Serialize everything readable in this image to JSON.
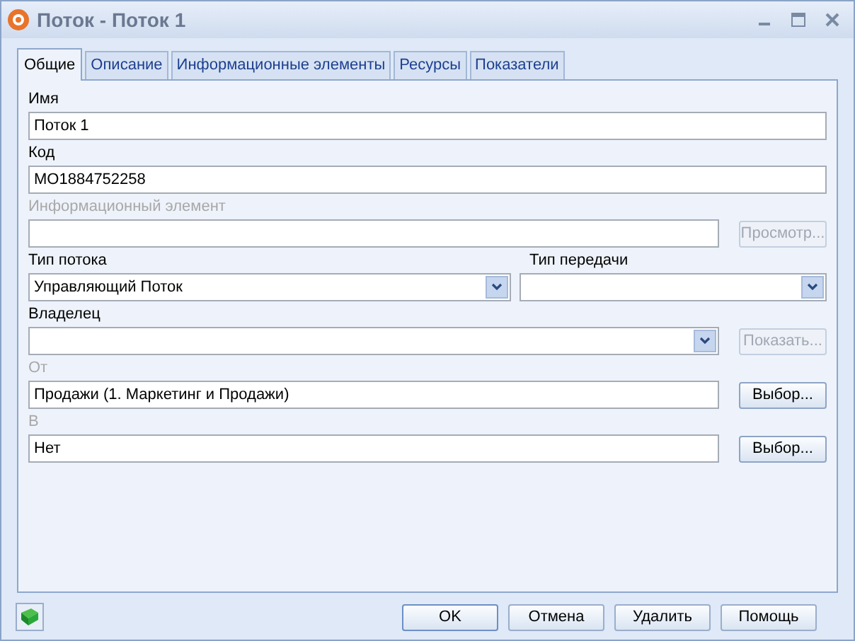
{
  "window": {
    "title": "Поток - Поток 1"
  },
  "tabs": [
    {
      "label": "Общие",
      "selected": true
    },
    {
      "label": "Описание",
      "selected": false
    },
    {
      "label": "Информационные элементы",
      "selected": false
    },
    {
      "label": "Ресурсы",
      "selected": false
    },
    {
      "label": "Показатели",
      "selected": false
    }
  ],
  "rows": [
    {
      "fields": [
        {
          "label": "Имя",
          "label_dimmed": false,
          "kind": "text",
          "value": "Поток 1"
        }
      ]
    },
    {
      "fields": [
        {
          "label": "Код",
          "label_dimmed": false,
          "kind": "text",
          "value": "MO1884752258"
        }
      ]
    },
    {
      "fields": [
        {
          "label": "Информационный элемент",
          "label_dimmed": true,
          "kind": "text"
        }
      ],
      "button": {
        "label": "Просмотр...",
        "disabled": true
      }
    },
    {
      "fields": [
        {
          "label": "Тип потока",
          "label_dimmed": false,
          "kind": "select",
          "value": "Управляющий Поток"
        },
        {
          "label": "Тип передачи",
          "label_dimmed": false,
          "kind": "select"
        }
      ]
    },
    {
      "fields": [
        {
          "label": "Владелец",
          "label_dimmed": false,
          "kind": "select"
        }
      ],
      "button": {
        "label": "Показать...",
        "disabled": true
      }
    },
    {
      "fields": [
        {
          "label": "От",
          "label_dimmed": true,
          "kind": "text",
          "value": "Продажи (1. Маркетинг и Продажи)"
        }
      ],
      "button": {
        "label": "Выбор...",
        "disabled": false
      }
    },
    {
      "fields": [
        {
          "label": "В",
          "label_dimmed": true,
          "kind": "text",
          "value": "Нет"
        }
      ],
      "button": {
        "label": "Выбор...",
        "disabled": false
      }
    }
  ],
  "buttons": [
    "OK",
    "Отмена",
    "Удалить",
    "Помощь"
  ]
}
